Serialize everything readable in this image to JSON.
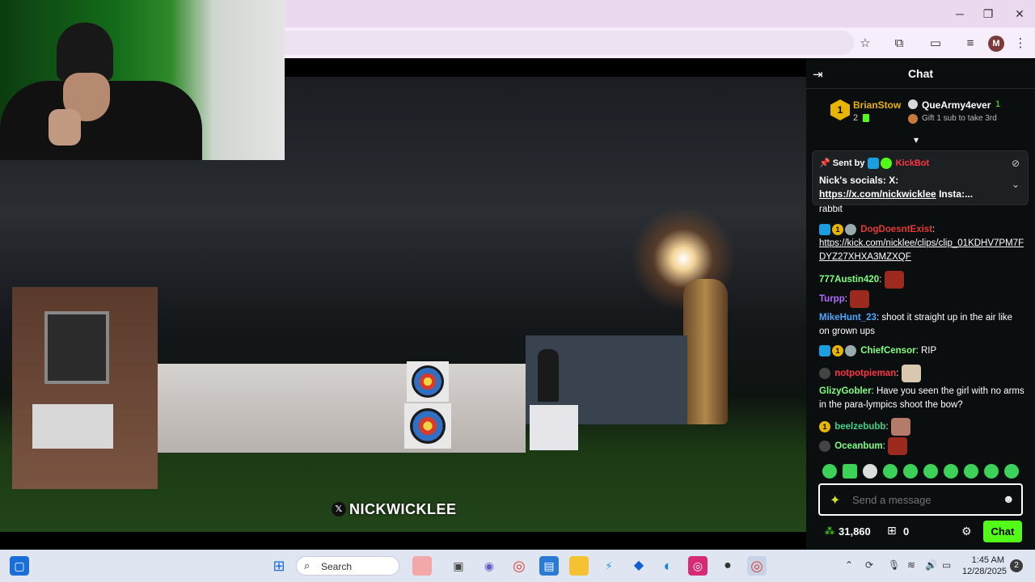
{
  "browser": {
    "window_controls": {
      "minimize": "─",
      "maximize": "❐",
      "close": "✕"
    },
    "profile_initial": "M"
  },
  "video": {
    "watermark": "NICKWICKLEE"
  },
  "chat": {
    "title": "Chat",
    "leaderboard": {
      "first": {
        "rank": "1",
        "name": "BrianStow",
        "count": "2"
      },
      "second": {
        "name": "QueArmy4ever",
        "count": "1"
      },
      "third_note": "Gift 1 sub to take 3rd"
    },
    "pinned": {
      "sent_by_label": "Sent by",
      "sender": "KickBot",
      "line1": "Nick's socials: X:",
      "link": "https://x.com/nickwicklee",
      "line2_suffix": "Insta:..."
    },
    "messages": [
      {
        "user": "",
        "text": "rabbit"
      },
      {
        "user": "DogDoesntExist",
        "text": "https://kick.com/nicklee/clips/clip_01KDHV7PM7FDYZ27XHXA3MZXQF"
      },
      {
        "user": "777Austin420",
        "text": ""
      },
      {
        "user": "Turpp",
        "text": ""
      },
      {
        "user": "MikeHunt_23",
        "text": "shoot it straight up in the air like on grown ups"
      },
      {
        "user": "ChiefCensor",
        "text": "RIP"
      },
      {
        "user": "notpotpieman",
        "text": ""
      },
      {
        "user": "GlizyGobler",
        "text": "Have you seen the girl with no arms in the para-lympics shoot the bow?"
      },
      {
        "user": "beelzebubb",
        "text": ""
      },
      {
        "user": "Oceanbum",
        "text": ""
      }
    ],
    "input_placeholder": "Send a message",
    "points": "31,860",
    "gifts": "0",
    "chat_button": "Chat"
  },
  "taskbar": {
    "search_label": "Search",
    "time": "1:45 AM",
    "date": "12/28/2025",
    "notifications": "2"
  }
}
